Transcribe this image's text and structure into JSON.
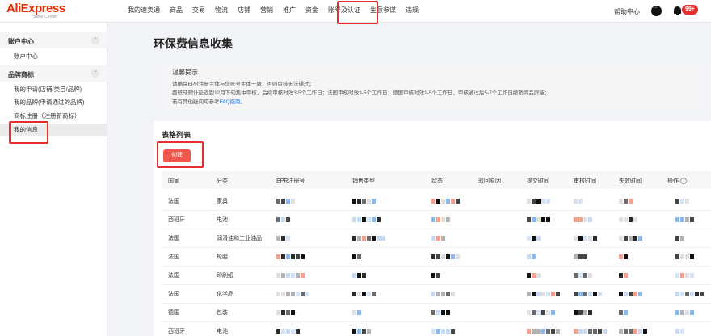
{
  "brand": {
    "name": "AliExpress",
    "subtitle": "Seller Center"
  },
  "nav": {
    "items": [
      "我的速卖通",
      "商品",
      "交易",
      "物流",
      "店铺",
      "营销",
      "推广",
      "资金",
      "账号及认证",
      "生意参谋",
      "违规"
    ],
    "active": "账号及认证",
    "help": "帮助中心",
    "badge": "99+"
  },
  "sidebar": {
    "groups": [
      {
        "title": "账户中心",
        "items": [
          "账户中心"
        ]
      },
      {
        "title": "品牌商标",
        "items": [
          "我的申请(店铺/类目/品牌)",
          "我的品牌(申请通过的品牌)",
          "商标注册（注册新商标）",
          "我的信息"
        ]
      }
    ],
    "active_item": "我的信息"
  },
  "page": {
    "title": "环保费信息收集"
  },
  "notice": {
    "title": "温馨提示",
    "lines": [
      "请确保EPR注册主体与您账号主体一致，否则审核无法通过；",
      "西班牙预计延迟到12月下旬集中审核，后续审核时效3-5个工作日；法国审核时效3-5个工作日；德国审核时效1-5个工作日，审核通过后5-7个工作日撤销商品屏蔽；"
    ],
    "faq_prefix": "若有其他疑问可参考",
    "faq_link": "FAQ指南",
    "faq_suffix": "。"
  },
  "table": {
    "title": "表格列表",
    "create_label": "创建",
    "columns": [
      "国家",
      "分类",
      "EPR注册号",
      "销售类型",
      "状态",
      "驳回原因",
      "提交时间",
      "审核时间",
      "失效时间",
      "操作"
    ],
    "rows": [
      {
        "country": "法国",
        "category": "家具"
      },
      {
        "country": "西班牙",
        "category": "电池"
      },
      {
        "country": "法国",
        "category": "润滑油和工业油品"
      },
      {
        "country": "法国",
        "category": "轮胎"
      },
      {
        "country": "法国",
        "category": "印刷纸"
      },
      {
        "country": "法国",
        "category": "化学品"
      },
      {
        "country": "德国",
        "category": "包装"
      },
      {
        "country": "西班牙",
        "category": "电池"
      }
    ]
  },
  "colors": {
    "accent": "#e62e04",
    "highlight": "#e62e2e",
    "button": "#f0574f",
    "link": "#1a73e8"
  },
  "icons": {
    "chat": "chat-bubble-icon",
    "bell": "bell-icon",
    "help": "question-circle-icon",
    "chevron": "chevron-up-icon"
  }
}
